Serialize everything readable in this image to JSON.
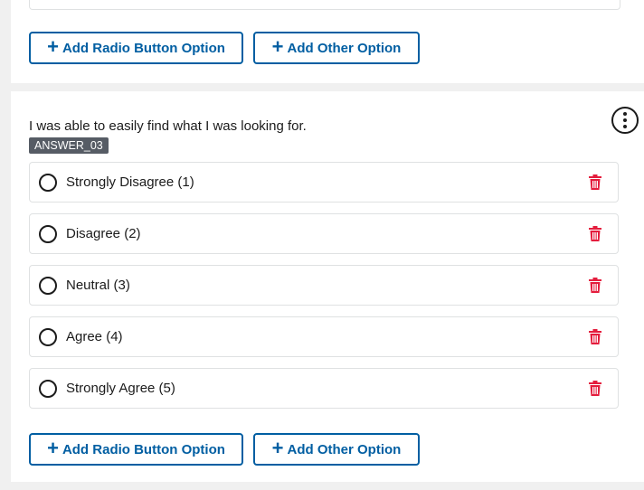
{
  "top_section": {
    "add_radio_label": "Add Radio Button Option",
    "add_other_label": "Add Other Option"
  },
  "question": {
    "text": "I was able to easily find what I was looking for.",
    "tag": "ANSWER_03",
    "options": [
      {
        "label": "Strongly Disagree (1)"
      },
      {
        "label": "Disagree (2)"
      },
      {
        "label": "Neutral (3)"
      },
      {
        "label": "Agree (4)"
      },
      {
        "label": "Strongly Agree (5)"
      }
    ],
    "add_radio_label": "Add Radio Button Option",
    "add_other_label": "Add Other Option"
  },
  "icons": {
    "plus": "plus-icon",
    "more": "more-vertical-icon",
    "delete": "trash-icon",
    "radio": "radio-unchecked-icon"
  },
  "colors": {
    "primary": "#005ea2",
    "delete": "#e41d3d",
    "tag_bg": "#565c65",
    "border": "#dfe1e2",
    "page_bg": "#f0f0f0"
  }
}
